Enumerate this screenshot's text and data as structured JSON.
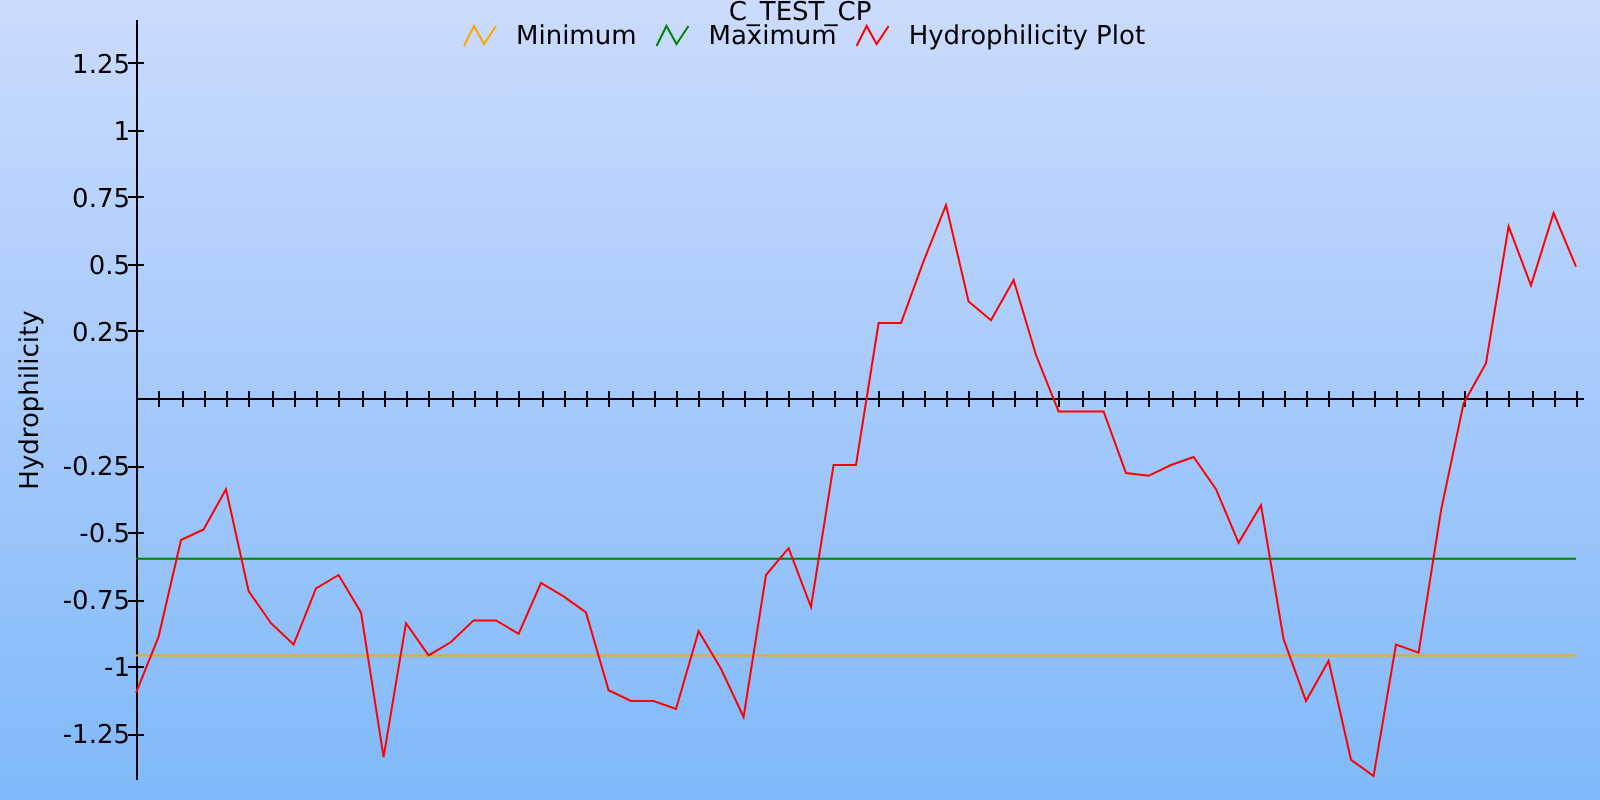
{
  "chart_data": {
    "type": "line",
    "title": "C_TEST_CP",
    "ylabel": "Hydrophilicity",
    "legend": true,
    "ylim": [
      -1.425,
      1.41
    ],
    "yticks": [
      {
        "value": -1.25,
        "label": "-1.25"
      },
      {
        "value": -1,
        "label": "-1"
      },
      {
        "value": -0.75,
        "label": "-0.75"
      },
      {
        "value": -0.5,
        "label": "-0.5"
      },
      {
        "value": -0.25,
        "label": "-0.25"
      },
      {
        "value": 0.25,
        "label": "0.25"
      },
      {
        "value": 0.5,
        "label": "0.5"
      },
      {
        "value": 0.75,
        "label": "0.75"
      },
      {
        "value": 1,
        "label": "1"
      },
      {
        "value": 1.25,
        "label": "1.25"
      }
    ],
    "series": [
      {
        "name": "Minimum",
        "color": "#ffa500",
        "values": [
          -0.96,
          -0.96,
          -0.96,
          -0.96,
          -0.96,
          -0.96,
          -0.96,
          -0.96,
          -0.96,
          -0.96,
          -0.96,
          -0.96,
          -0.96,
          -0.96,
          -0.96,
          -0.96,
          -0.96,
          -0.96,
          -0.96,
          -0.96,
          -0.96,
          -0.96,
          -0.96,
          -0.96,
          -0.96,
          -0.96,
          -0.96,
          -0.96,
          -0.96,
          -0.96,
          -0.96,
          -0.96,
          -0.96,
          -0.96,
          -0.96,
          -0.96,
          -0.96,
          -0.96,
          -0.96,
          -0.96,
          -0.96,
          -0.96,
          -0.96,
          -0.96,
          -0.96,
          -0.96,
          -0.96,
          -0.96,
          -0.96,
          -0.96,
          -0.96,
          -0.96,
          -0.96,
          -0.96,
          -0.96,
          -0.96,
          -0.96,
          -0.96,
          -0.96,
          -0.96,
          -0.96,
          -0.96,
          -0.96,
          -0.96,
          -0.96
        ]
      },
      {
        "name": "Maximum",
        "color": "#008000",
        "values": [
          -0.6,
          -0.6,
          -0.6,
          -0.6,
          -0.6,
          -0.6,
          -0.6,
          -0.6,
          -0.6,
          -0.6,
          -0.6,
          -0.6,
          -0.6,
          -0.6,
          -0.6,
          -0.6,
          -0.6,
          -0.6,
          -0.6,
          -0.6,
          -0.6,
          -0.6,
          -0.6,
          -0.6,
          -0.6,
          -0.6,
          -0.6,
          -0.6,
          -0.6,
          -0.6,
          -0.6,
          -0.6,
          -0.6,
          -0.6,
          -0.6,
          -0.6,
          -0.6,
          -0.6,
          -0.6,
          -0.6,
          -0.6,
          -0.6,
          -0.6,
          -0.6,
          -0.6,
          -0.6,
          -0.6,
          -0.6,
          -0.6,
          -0.6,
          -0.6,
          -0.6,
          -0.6,
          -0.6,
          -0.6,
          -0.6,
          -0.6,
          -0.6,
          -0.6,
          -0.6,
          -0.6,
          -0.6,
          -0.6,
          -0.6,
          -0.6
        ]
      },
      {
        "name": "Hydrophilicity Plot",
        "color": "#ff0000",
        "values": [
          -1.1,
          -0.89,
          -0.53,
          -0.49,
          -0.34,
          -0.72,
          -0.84,
          -0.92,
          -0.71,
          -0.66,
          -0.8,
          -1.34,
          -0.84,
          -0.96,
          -0.91,
          -0.83,
          -0.83,
          -0.88,
          -0.69,
          -0.74,
          -0.8,
          -1.09,
          -1.13,
          -1.13,
          -1.16,
          -0.87,
          -1.01,
          -1.19,
          -0.66,
          -0.56,
          -0.78,
          -0.25,
          -0.25,
          0.28,
          0.28,
          0.51,
          0.72,
          0.36,
          0.29,
          0.44,
          0.16,
          -0.05,
          -0.05,
          -0.05,
          -0.28,
          -0.29,
          -0.25,
          -0.22,
          -0.34,
          -0.54,
          -0.4,
          -0.9,
          -1.13,
          -0.98,
          -1.35,
          -1.41,
          -0.92,
          -0.95,
          -0.42,
          -0.02,
          0.13,
          0.64,
          0.42,
          0.69,
          0.49
        ]
      }
    ]
  }
}
